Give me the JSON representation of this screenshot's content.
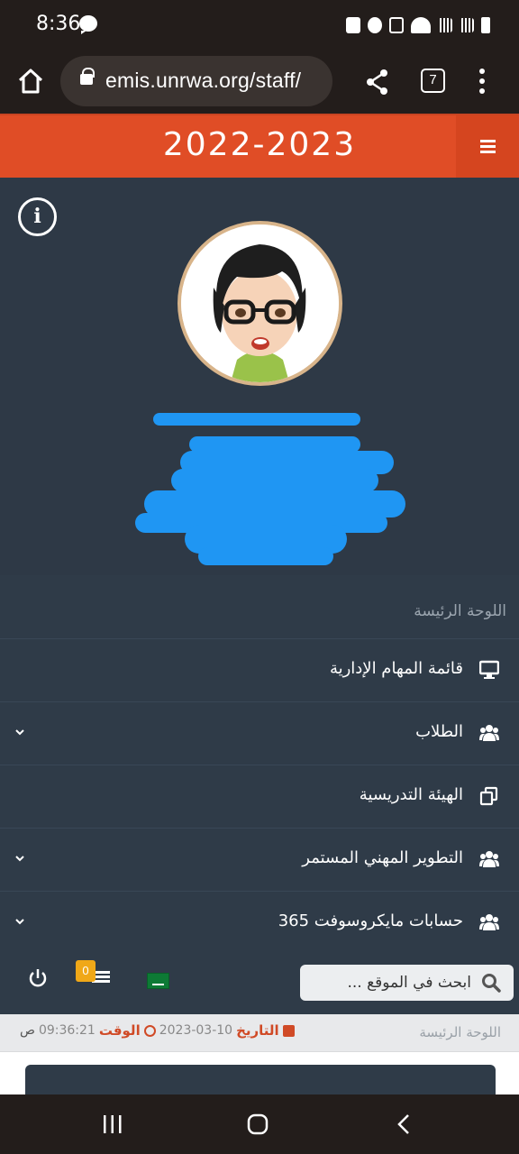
{
  "status_bar": {
    "time": "8:36"
  },
  "browser": {
    "url": "emis.unrwa.org/staff/",
    "tab_count": "7"
  },
  "header": {
    "title": "2022-2023"
  },
  "profile": {
    "info_label": "i"
  },
  "nav": {
    "section_title": "اللوحة الرئيسة",
    "items": [
      {
        "label": "قائمة المهام الإدارية",
        "icon": "desktop-icon",
        "expandable": false
      },
      {
        "label": "الطلاب",
        "icon": "users-icon",
        "expandable": true
      },
      {
        "label": "الهيئة التدريسية",
        "icon": "copy-icon",
        "expandable": false
      },
      {
        "label": "التطوير المهني المستمر",
        "icon": "users-icon",
        "expandable": true
      },
      {
        "label": "حسابات مايكروسوفت 365",
        "icon": "users-icon",
        "expandable": true
      }
    ]
  },
  "toolbar": {
    "notification_count": "0",
    "search_placeholder": "ابحث في الموقع ..."
  },
  "breadcrumb": {
    "home": "اللوحة الرئيسة",
    "date_label": "التاريخ",
    "date_value": "2023-03-10",
    "time_label": "الوقت",
    "time_value": "09:36:21",
    "ampm": "ص"
  },
  "colors": {
    "header": "#e04d26",
    "panel": "#2f3b48",
    "accent": "#d04a26",
    "badge": "#f0a818"
  }
}
